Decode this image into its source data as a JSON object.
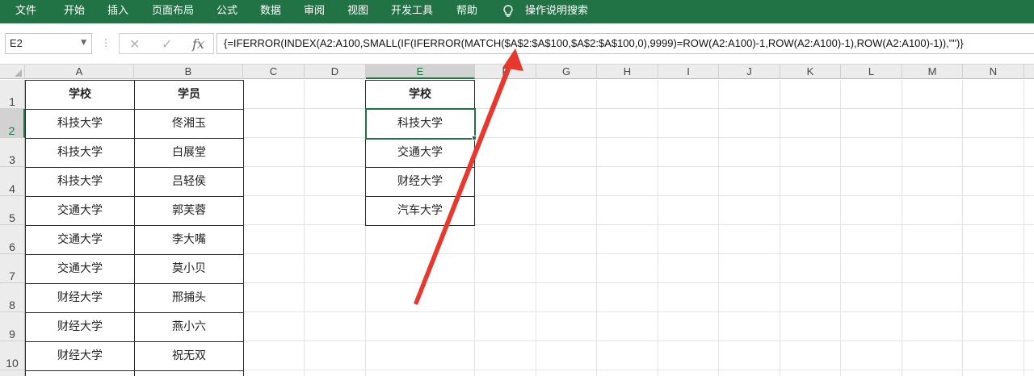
{
  "ribbon": {
    "tabs": [
      "文件",
      "开始",
      "插入",
      "页面布局",
      "公式",
      "数据",
      "审阅",
      "视图",
      "开发工具",
      "帮助"
    ],
    "tell_me": "操作说明搜索",
    "accent": "#217346"
  },
  "formula_bar": {
    "name_box": "E2",
    "cancel_icon": "✕",
    "enter_icon": "✓",
    "fx_label": "fx",
    "formula": "{=IFERROR(INDEX(A2:A100,SMALL(IF(IFERROR(MATCH($A$2:$A$100,$A$2:$A$100,0),9999)=ROW(A2:A100)-1,ROW(A2:A100)-1),ROW(A2:A100)-1)),\"\")}"
  },
  "columns": [
    "A",
    "B",
    "C",
    "D",
    "E",
    "F",
    "G",
    "H",
    "I",
    "J",
    "K",
    "L",
    "M",
    "N"
  ],
  "selected_cell": {
    "column": "E",
    "row": "2"
  },
  "rows": [
    "1",
    "2",
    "3",
    "4",
    "5",
    "6",
    "7",
    "8",
    "9",
    "10"
  ],
  "table_ab": {
    "headers": [
      "学校",
      "学员"
    ],
    "rows": [
      [
        "科技大学",
        "佟湘玉"
      ],
      [
        "科技大学",
        "白展堂"
      ],
      [
        "科技大学",
        "吕轻侯"
      ],
      [
        "交通大学",
        "郭芙蓉"
      ],
      [
        "交通大学",
        "李大嘴"
      ],
      [
        "交通大学",
        "莫小贝"
      ],
      [
        "财经大学",
        "邢捕头"
      ],
      [
        "财经大学",
        "燕小六"
      ],
      [
        "财经大学",
        "祝无双"
      ]
    ]
  },
  "table_e": {
    "header": "学校",
    "rows": [
      "科技大学",
      "交通大学",
      "财经大学",
      "汽车大学"
    ]
  },
  "annotation": {
    "arrow_color": "#e8372c"
  }
}
